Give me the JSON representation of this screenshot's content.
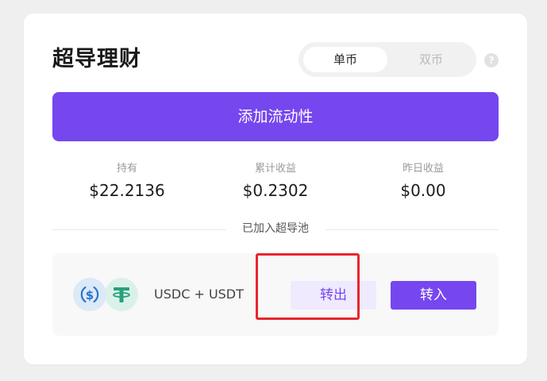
{
  "card": {
    "title": "超导理财",
    "tabs": [
      {
        "label": "单币",
        "active": true
      },
      {
        "label": "双币",
        "active": false
      }
    ],
    "help_icon": "question-circle-icon",
    "add_liquidity_label": "添加流动性"
  },
  "stats": [
    {
      "label": "持有",
      "value": "$22.2136"
    },
    {
      "label": "累计收益",
      "value": "$0.2302"
    },
    {
      "label": "昨日收益",
      "value": "$0.00"
    }
  ],
  "section_label": "已加入超导池",
  "pool": {
    "pair": "USDC + USDT",
    "coins": [
      {
        "icon": "usdc-coin-icon",
        "color": "#2775ca"
      },
      {
        "icon": "usdt-coin-icon",
        "color": "#26a17b"
      }
    ],
    "transfer_out_label": "转出",
    "transfer_in_label": "转入"
  },
  "colors": {
    "accent": "#7646ef",
    "highlight": "#e8262d"
  }
}
